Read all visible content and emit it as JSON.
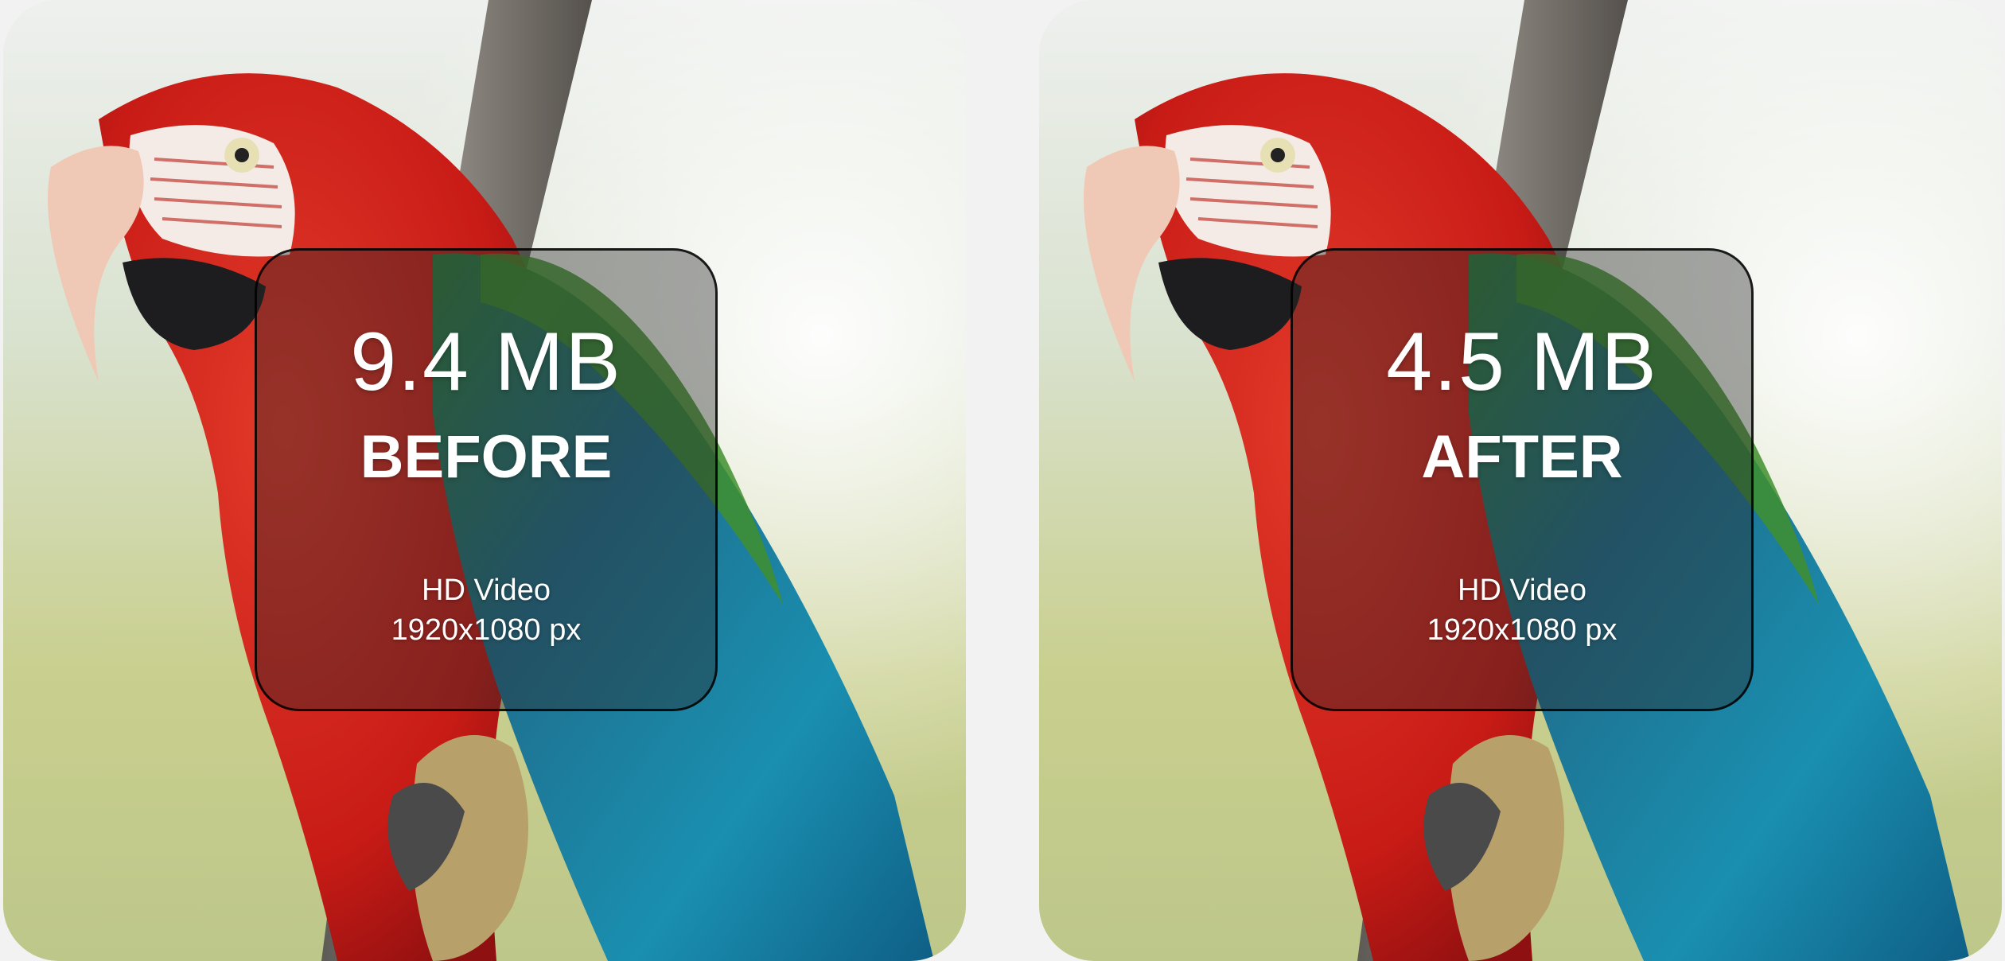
{
  "comparison": {
    "before": {
      "size": "9.4 MB",
      "label": "BEFORE",
      "format": "HD Video",
      "resolution": "1920x1080 px"
    },
    "after": {
      "size": "4.5 MB",
      "label": "AFTER",
      "format": "HD Video",
      "resolution": "1920x1080 px"
    }
  },
  "colors": {
    "page_background": "#f2f2f2",
    "overlay_tint": "rgba(40,40,40,0.40)",
    "overlay_border": "#000000",
    "text": "#ffffff"
  }
}
